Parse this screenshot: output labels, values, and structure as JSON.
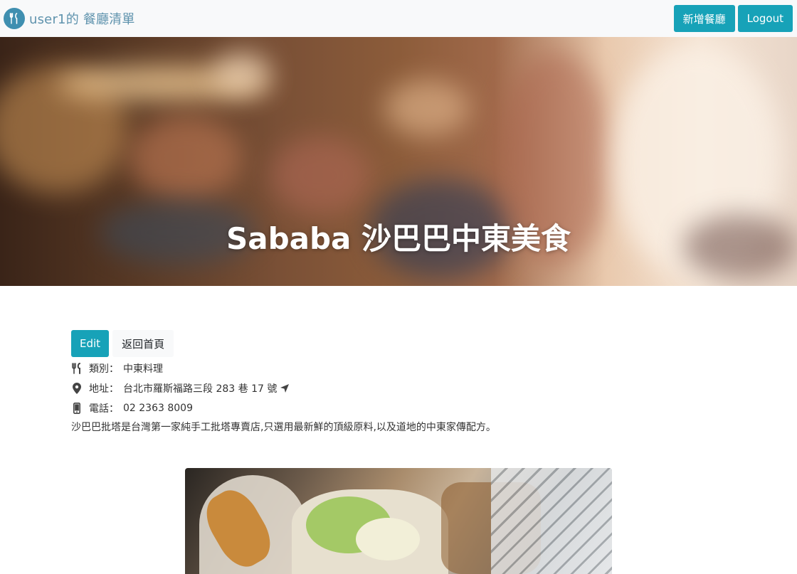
{
  "navbar": {
    "brand_text": "user1的 餐廳清單",
    "logo_icon": "utensils-icon",
    "add_button": "新增餐廳",
    "logout_button": "Logout",
    "accent_color": "#17a2b8"
  },
  "banner": {
    "title": "Sababa 沙巴巴中東美食"
  },
  "actions": {
    "edit_button": "Edit",
    "back_button": "返回首頁"
  },
  "details": {
    "category_label": "類別：",
    "category_value": "中東料理",
    "address_label": "地址：",
    "address_value": "台北市羅斯福路三段 283 巷 17 號",
    "phone_label": "電話：",
    "phone_value": "02 2363 8009",
    "description": "沙巴巴批塔是台灣第一家純手工批塔專賣店,只選用最新鮮的頂級原料,以及道地的中東家傳配方。"
  },
  "icons": {
    "category": "utensils-icon",
    "address": "map-marker-icon",
    "directions": "location-arrow-icon",
    "phone": "mobile-phone-icon"
  }
}
